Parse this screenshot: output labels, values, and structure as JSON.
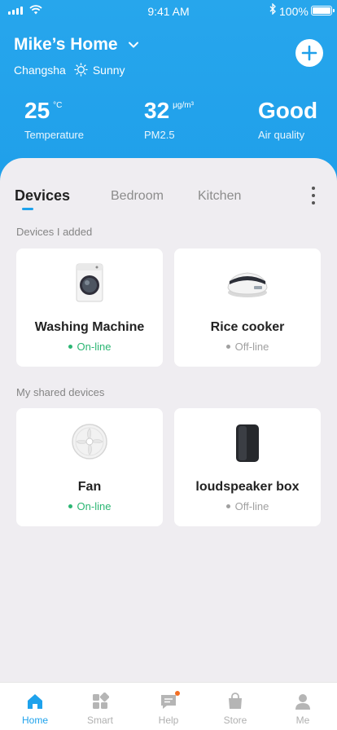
{
  "status_bar": {
    "time": "9:41 AM",
    "battery": "100%"
  },
  "header": {
    "home_name": "Mike’s Home",
    "city": "Changsha",
    "weather": "Sunny",
    "stats": [
      {
        "value": "25",
        "unit": "°C",
        "label": "Temperature"
      },
      {
        "value": "32",
        "unit": "μg/m³",
        "label": "PM2.5"
      },
      {
        "value": "Good",
        "unit": "",
        "label": "Air quality"
      }
    ]
  },
  "tabs": [
    "Devices",
    "Bedroom",
    "Kitchen"
  ],
  "sections": {
    "added": "Devices I added",
    "shared": "My shared devices"
  },
  "devices_added": [
    {
      "name": "Washing Machine",
      "status": "On-line",
      "icon": "washing-machine-icon"
    },
    {
      "name": "Rice cooker",
      "status": "Off-line",
      "icon": "rice-cooker-icon"
    }
  ],
  "devices_shared": [
    {
      "name": "Fan",
      "status": "On-line",
      "icon": "fan-icon"
    },
    {
      "name": "loudspeaker box",
      "status": "Off-line",
      "icon": "speaker-icon"
    }
  ],
  "tabbar": [
    "Home",
    "Smart",
    "Help",
    "Store",
    "Me"
  ],
  "colors": {
    "accent": "#1ea2ec",
    "online": "#2bb673",
    "offline": "#a0a0a0",
    "badge": "#f36f24"
  }
}
